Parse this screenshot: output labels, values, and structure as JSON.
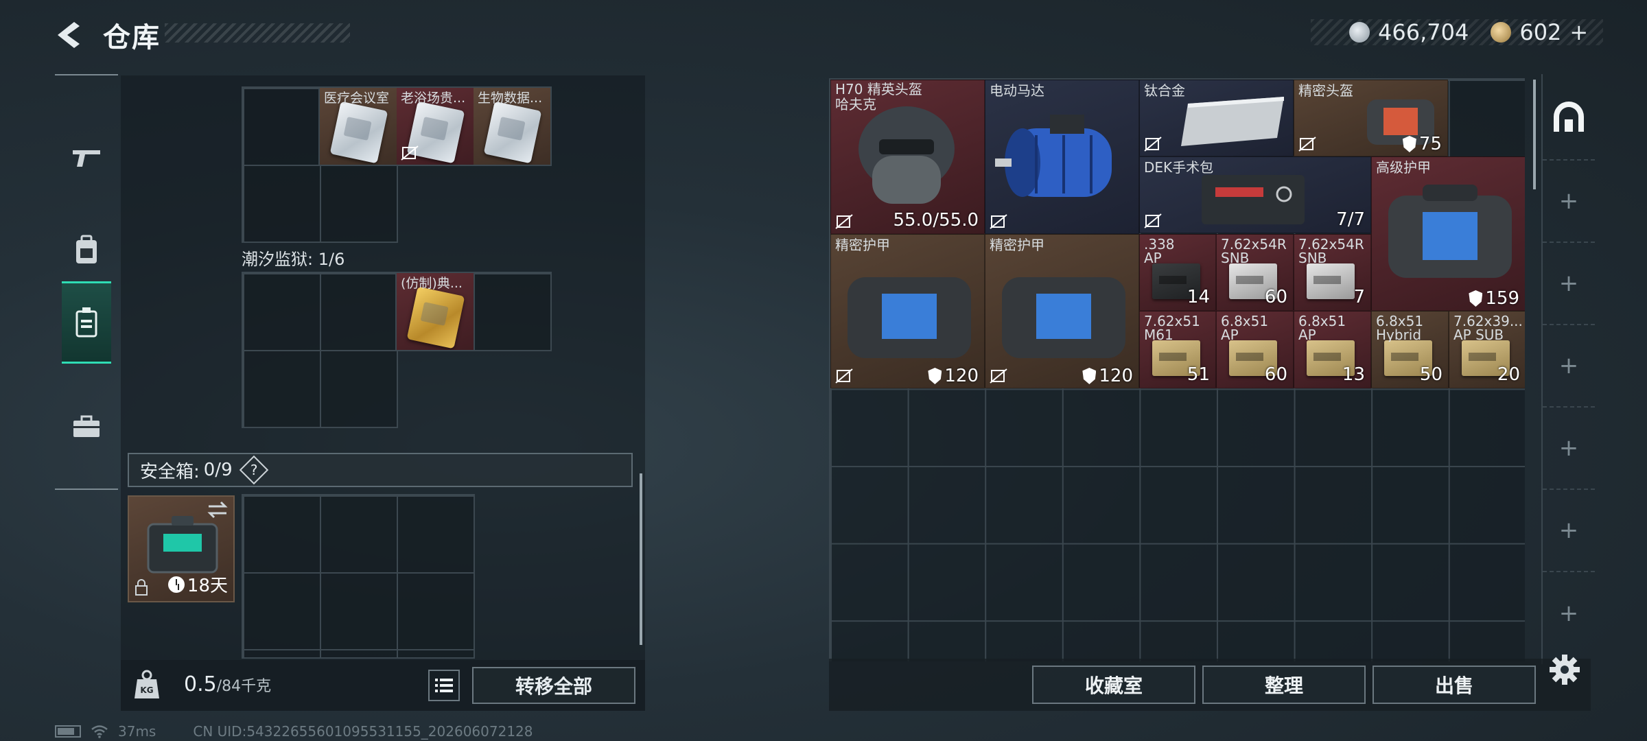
{
  "header": {
    "title": "仓库",
    "silver_amount": "466,704",
    "gold_amount": "602",
    "gold_plus": "+"
  },
  "left_nav": {
    "items": [
      "weapon-icon",
      "backpack-icon",
      "vest-icon",
      "toolbox-icon"
    ],
    "active": "vest-icon"
  },
  "containers": {
    "top_items": [
      {
        "name": "医疗会议室",
        "color": "brown",
        "tradeable": true
      },
      {
        "name": "老浴场贵...",
        "color": "red",
        "tradeable": false
      },
      {
        "name": "生物数据...",
        "color": "brown",
        "tradeable": true
      }
    ],
    "prison_label": "潮汐监狱: 1/6",
    "prison_items": [
      {
        "name": "(仿制)典...",
        "color": "red"
      }
    ]
  },
  "safe_box": {
    "label": "安全箱:",
    "count": "0/9",
    "help": "?",
    "days_left": "18天"
  },
  "left_footer": {
    "weight_icon_label": "KG",
    "weight_current": "0.5",
    "weight_max": "/84千克",
    "transfer_all": "转移全部"
  },
  "status_bar": {
    "ping": "37ms",
    "uid": "CN UID:54322655601095531155_202606072128"
  },
  "stash_items": [
    {
      "id": "h70",
      "name": "H70 精英头盔\n哈夫克",
      "color": "red",
      "count": "55.0/55.0",
      "notrade": true
    },
    {
      "id": "motor",
      "name": "电动马达",
      "color": "navy",
      "count": "",
      "notrade": true
    },
    {
      "id": "titanium",
      "name": "钛合金",
      "color": "navy",
      "count": "",
      "notrade": true
    },
    {
      "id": "precision-helmet",
      "name": "精密头盔",
      "color": "brown",
      "count": "75",
      "notrade": true,
      "shield": true
    },
    {
      "id": "dek",
      "name": "DEK手术包",
      "color": "navy",
      "count": "7/7",
      "notrade": true
    },
    {
      "id": "advanced-armor",
      "name": "高级护甲",
      "color": "red",
      "count": "159",
      "shield": true
    },
    {
      "id": "precision-armor-1",
      "name": "精密护甲",
      "color": "brown",
      "count": "120",
      "notrade": true,
      "shield": true
    },
    {
      "id": "precision-armor-2",
      "name": "精密护甲",
      "color": "brown",
      "count": "120",
      "notrade": true,
      "shield": true
    },
    {
      "id": "ammo-338",
      "name": ".338\nAP",
      "color": "red",
      "count": "14"
    },
    {
      "id": "ammo-762x54-1",
      "name": "7.62x54R\nSNB",
      "color": "red",
      "count": "60"
    },
    {
      "id": "ammo-762x54-2",
      "name": "7.62x54R\nSNB",
      "color": "red",
      "count": "7"
    },
    {
      "id": "ammo-762x51",
      "name": "7.62x51\nM61",
      "color": "red",
      "count": "51"
    },
    {
      "id": "ammo-68-1",
      "name": "6.8x51\nAP",
      "color": "red",
      "count": "60"
    },
    {
      "id": "ammo-68-2",
      "name": "6.8x51\nAP",
      "color": "red",
      "count": "13"
    },
    {
      "id": "ammo-68-hybrid",
      "name": "6.8x51\nHybrid",
      "color": "brown",
      "count": "50"
    },
    {
      "id": "ammo-762x39",
      "name": "7.62x39...\nAP SUB",
      "color": "brown",
      "count": "20"
    }
  ],
  "right_footer": {
    "collection": "收藏室",
    "sort": "整理",
    "sell": "出售"
  },
  "colors": {
    "accent": "#2fdcb4",
    "item_red": "#5e2c33",
    "item_brown": "#584435",
    "item_navy": "#2b3246"
  }
}
